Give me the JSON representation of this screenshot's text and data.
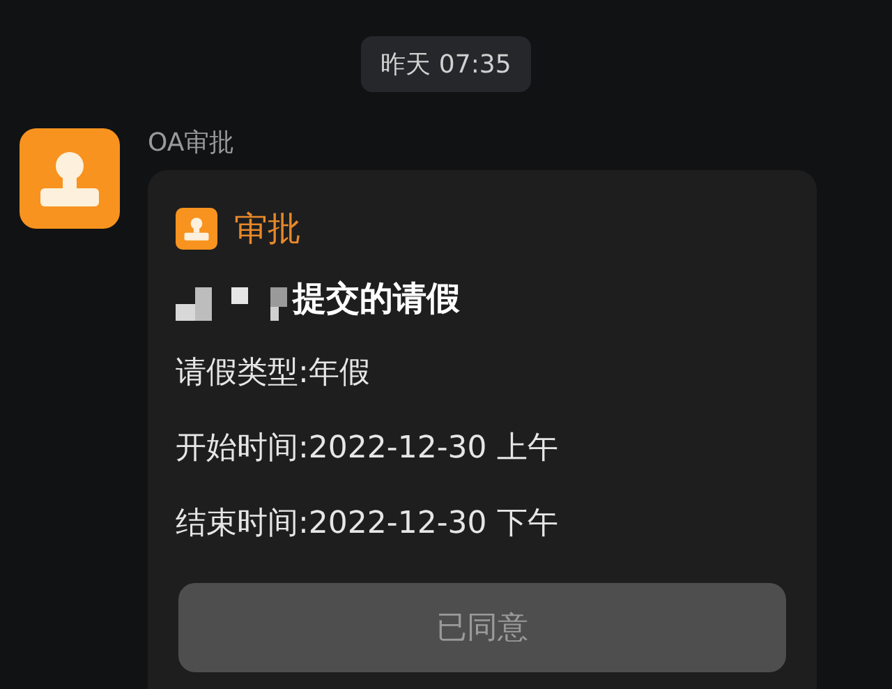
{
  "timestamp": "昨天 07:35",
  "message": {
    "sender": "OA审批",
    "card": {
      "app_name": "审批",
      "title": "提交的请假",
      "fields": [
        {
          "label": "请假类型:",
          "value": "年假"
        },
        {
          "label": "开始时间:",
          "value": "2022-12-30 上午"
        },
        {
          "label": "结束时间:",
          "value": "2022-12-30 下午"
        }
      ],
      "button": {
        "label": "已同意",
        "disabled": true
      }
    }
  }
}
